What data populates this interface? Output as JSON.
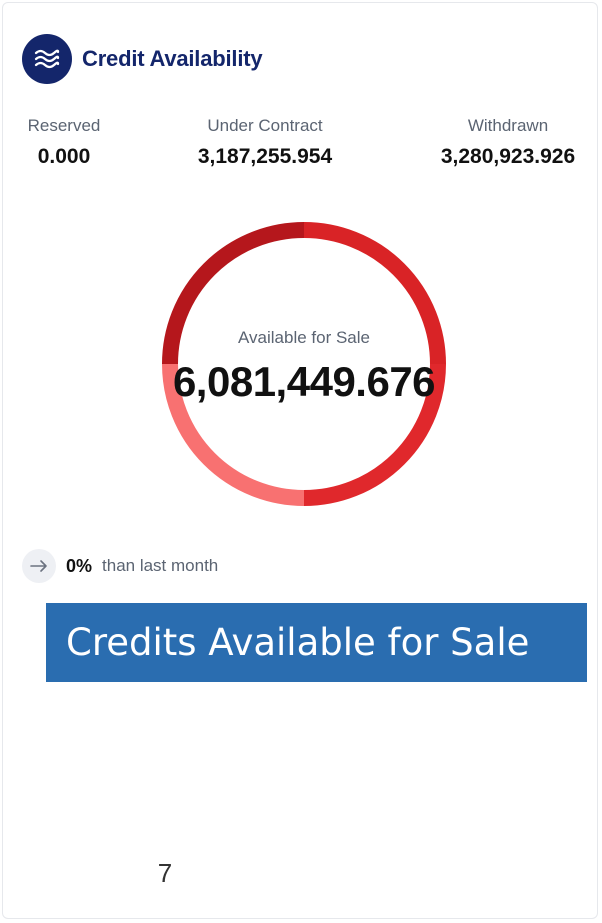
{
  "header": {
    "title": "Credit Availability",
    "icon": "waves-icon"
  },
  "stats": {
    "reserved": {
      "label": "Reserved",
      "value": "0.000"
    },
    "under_contract": {
      "label": "Under Contract",
      "value": "3,187,255.954"
    },
    "withdrawn": {
      "label": "Withdrawn",
      "value": "3,280,923.926"
    }
  },
  "donut": {
    "label": "Available for Sale",
    "value": "6,081,449.676",
    "segments": [
      {
        "name": "segment-1",
        "fraction": 0.25,
        "color": "#e0282c"
      },
      {
        "name": "segment-2",
        "fraction": 0.25,
        "color": "#f87171"
      },
      {
        "name": "segment-3",
        "fraction": 0.25,
        "color": "#b5171c"
      },
      {
        "name": "segment-4",
        "fraction": 0.25,
        "color": "#d92326"
      }
    ]
  },
  "trend": {
    "icon": "arrow-right-icon",
    "percent": "0%",
    "text": "than last month"
  },
  "banner": {
    "text": "Credits Available for Sale",
    "color": "#2a6db0"
  },
  "page_number": "7"
}
